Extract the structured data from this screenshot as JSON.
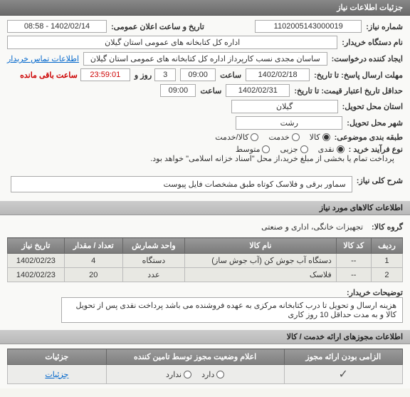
{
  "header": {
    "title": "جزئیات اطلاعات نیاز"
  },
  "info": {
    "need_no_label": "شماره نیاز:",
    "need_no": "1102005143000019",
    "announce_label": "تاریخ و ساعت اعلان عمومی:",
    "announce_value": "1402/02/14 - 08:58",
    "buyer_label": "نام دستگاه خریدار:",
    "buyer_value": "اداره کل کتابخانه های عمومی استان گیلان",
    "requester_label": "ایجاد کننده درخواست:",
    "requester_value": "ساسان مجدی نسب کارپرداز اداره کل کتابخانه های عمومی استان گیلان",
    "contact_link": "اطلاعات تماس خریدار",
    "deadline_label": "مهلت ارسال پاسخ: تا تاریخ:",
    "deadline_date": "1402/02/18",
    "time_label": "ساعت",
    "deadline_hour": "09:00",
    "deadline_min": "3",
    "day_word": "روز و",
    "remain_time": "23:59:01",
    "remain_label": "ساعت باقی مانده",
    "credit_label": "حداقل تاریخ اعتبار قیمت: تا تاریخ:",
    "credit_date": "1402/02/31",
    "credit_hour": "09:00",
    "province_label": "استان محل تحویل:",
    "province_value": "گیلان",
    "city_label": "شهر محل تحویل:",
    "city_value": "رشت",
    "cat_label": "طبقه بندی موضوعی:",
    "cat_opts": [
      "کالا",
      "خدمت",
      "کالا/خدمت"
    ],
    "purchase_type_label": "نوع فرآیند خرید :",
    "purchase_opts": [
      "نقدی",
      "جزیی",
      "متوسط"
    ],
    "purchase_note": "پرداخت تمام یا بخشی از مبلغ خرید،از محل \"اسناد خزانه اسلامی\" خواهد بود."
  },
  "description": {
    "label": "شرح کلی نیاز:",
    "text": "سماور برقی و فلاسک کوتاه طبق مشخصات فایل پیوست"
  },
  "goods": {
    "header": "اطلاعات کالاهای مورد نیاز",
    "group_label": "گروه کالا:",
    "group_value": "تجهیزات خانگی، اداری و صنعتی",
    "columns": [
      "ردیف",
      "کد کالا",
      "نام کالا",
      "واحد شمارش",
      "تعداد / مقدار",
      "تاریخ نیاز"
    ],
    "rows": [
      {
        "idx": "1",
        "code": "--",
        "name": "دستگاه آب جوش کن (آب جوش ساز)",
        "unit": "دستگاه",
        "qty": "4",
        "date": "1402/02/23"
      },
      {
        "idx": "2",
        "code": "--",
        "name": "فلاسک",
        "unit": "عدد",
        "qty": "20",
        "date": "1402/02/23"
      }
    ],
    "notes_label": "توضیحات خریدار:",
    "notes_text": "هزینه ارسال و تحویل تا درب کتابخانه مرکزی به عهده فروشنده می باشد پرداخت نقدی پس از تحویل کالا و به مدت حداقل 10 روز کاری"
  },
  "permits": {
    "header": "اطلاعات مجوزهای ارائه خدمت / کالا",
    "columns": [
      "الزامی بودن ارائه مجوز",
      "اعلام وضعیت مجوز توسط تامین کننده",
      "جزئیات"
    ],
    "row": {
      "mandatory": "✓",
      "status": "دارد",
      "details_link": "جزئیات"
    },
    "status_opts": [
      "دارد",
      "ندارد"
    ]
  }
}
